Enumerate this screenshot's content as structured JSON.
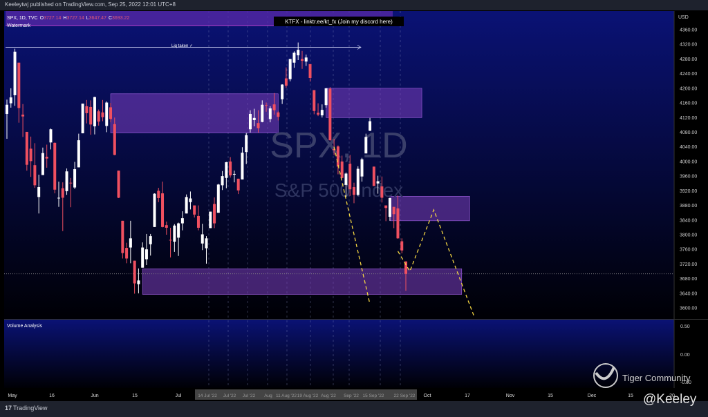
{
  "header": {
    "published": "Keeleytwj published on TradingView.com, Sep 25, 2022 12:01 UTC+8"
  },
  "legend": {
    "symbol": "SPX, 1D, TVC",
    "o_label": "O",
    "o": "3727.14",
    "h_label": "H",
    "h": "3727.14",
    "l_label": "L",
    "l": "3647.47",
    "c_label": "C",
    "c": "3693.22",
    "indicator": "Watermark"
  },
  "banner": "KTFX - linktr.ee/kt_fx (Join my discord here)",
  "annotation": "Liq taken ✓",
  "watermark": {
    "title": "SPX, 1D",
    "subtitle": "S&P 500 Index"
  },
  "volume_pane": {
    "title": "Volume Analysis",
    "ticks": [
      "0.50",
      "0.00",
      "-0.50"
    ]
  },
  "logo": {
    "text": "Tiger Community",
    "icon": "tiger-logo-icon"
  },
  "signature": "@Keeley",
  "footer": {
    "brand_icon": "tradingview-logo-icon",
    "brand": "TradingView"
  },
  "colors": {
    "up": "#ffffff",
    "down": "#f05060",
    "zone": "#7b3fbf",
    "projection": "#f5d742",
    "background_top": "#0a1275"
  },
  "chart_data": {
    "type": "candlestick",
    "currency": "USD",
    "price_ticks": [
      4360,
      4320,
      4280,
      4240,
      4200,
      4160,
      4120,
      4080,
      4040,
      4000,
      3960,
      3920,
      3880,
      3840,
      3800,
      3760,
      3720,
      3680,
      3640,
      3600
    ],
    "ylim": [
      3580,
      4400
    ],
    "x_ticks": [
      "May",
      "16",
      "Jun",
      "15",
      "Jul",
      "Oct",
      "17",
      "Nov",
      "15",
      "Dec",
      "15",
      "20"
    ],
    "x_ticks_grey": [
      "14 Jul '22",
      "Jul '22",
      "Jul '22",
      "Aug",
      "11 Aug '22",
      "19 Aug '22",
      "Aug '22",
      "Sep '22",
      "15 Sep '22",
      "22 Sep '22"
    ],
    "current_price": 3693.22,
    "liq_level": 4312,
    "zones": [
      {
        "from": 26,
        "to": 68,
        "top": 4185,
        "bottom": 4078
      },
      {
        "from": 80,
        "to": 104,
        "top": 4200,
        "bottom": 4120
      },
      {
        "from": 96,
        "to": 116,
        "top": 3905,
        "bottom": 3838
      },
      {
        "from": 34,
        "to": 114,
        "top": 3707,
        "bottom": 3637
      }
    ],
    "ohlc": [
      [
        4130,
        4169,
        4062,
        4155
      ],
      [
        4159,
        4200,
        4147,
        4175
      ],
      [
        4181,
        4308,
        4152,
        4300
      ],
      [
        4270,
        4270,
        4106,
        4146
      ],
      [
        4128,
        4157,
        4067,
        4123
      ],
      [
        4081,
        4081,
        3975,
        3991
      ],
      [
        4035,
        4068,
        3958,
        4001
      ],
      [
        3990,
        4050,
        3928,
        3935
      ],
      [
        3903,
        3964,
        3858,
        3930
      ],
      [
        3963,
        4038,
        3963,
        4023
      ],
      [
        4013,
        4046,
        3983,
        4008
      ],
      [
        4052,
        4090,
        4033,
        4088
      ],
      [
        4051,
        4052,
        3913,
        3923
      ],
      [
        3899,
        3945,
        3876,
        3901
      ],
      [
        3927,
        3943,
        3810,
        3901
      ],
      [
        3919,
        3981,
        3909,
        3973
      ],
      [
        3942,
        3955,
        3875,
        3941
      ],
      [
        3929,
        3999,
        3925,
        3979
      ],
      [
        3984,
        4076,
        3984,
        4058
      ],
      [
        4077,
        4158,
        4077,
        4158
      ],
      [
        4151,
        4168,
        4104,
        4132
      ],
      [
        4149,
        4167,
        4073,
        4101
      ],
      [
        4096,
        4177,
        4074,
        4176
      ],
      [
        4137,
        4142,
        4098,
        4109
      ],
      [
        4134,
        4168,
        4110,
        4121
      ],
      [
        4097,
        4164,
        4080,
        4161
      ],
      [
        4148,
        4160,
        4107,
        4116
      ],
      [
        4102,
        4120,
        4017,
        4018
      ],
      [
        3975,
        3975,
        3900,
        3901
      ],
      [
        3838,
        3838,
        3735,
        3750
      ],
      [
        3764,
        3778,
        3722,
        3735
      ],
      [
        3765,
        3838,
        3722,
        3790
      ],
      [
        3729,
        3729,
        3639,
        3667
      ],
      [
        3665,
        3708,
        3640,
        3675
      ],
      [
        3710,
        3779,
        3710,
        3765
      ],
      [
        3733,
        3802,
        3717,
        3760
      ],
      [
        3774,
        3802,
        3743,
        3796
      ],
      [
        3821,
        3913,
        3821,
        3912
      ],
      [
        3920,
        3928,
        3889,
        3900
      ],
      [
        3913,
        3945,
        3820,
        3821
      ],
      [
        3826,
        3836,
        3800,
        3819
      ],
      [
        3786,
        3819,
        3738,
        3785
      ],
      [
        3781,
        3829,
        3753,
        3825
      ],
      [
        3792,
        3833,
        3742,
        3831
      ],
      [
        3831,
        3864,
        3812,
        3845
      ],
      [
        3858,
        3910,
        3858,
        3903
      ],
      [
        3889,
        3918,
        3869,
        3899
      ],
      [
        3880,
        3880,
        3847,
        3855
      ],
      [
        3851,
        3880,
        3812,
        3819
      ],
      [
        3776,
        3830,
        3758,
        3801
      ],
      [
        3763,
        3796,
        3721,
        3790
      ],
      [
        3818,
        3863,
        3818,
        3863
      ],
      [
        3884,
        3902,
        3818,
        3831
      ],
      [
        3860,
        3939,
        3860,
        3937
      ],
      [
        3935,
        3974,
        3922,
        3960
      ],
      [
        3955,
        3999,
        3927,
        3998
      ],
      [
        4000,
        4012,
        3956,
        3962
      ],
      [
        3966,
        3975,
        3943,
        3966
      ],
      [
        3953,
        3953,
        3911,
        3921
      ],
      [
        3951,
        4039,
        3951,
        4024
      ],
      [
        4026,
        4078,
        3993,
        4072
      ],
      [
        4088,
        4140,
        4079,
        4130
      ],
      [
        4113,
        4144,
        4096,
        4119
      ],
      [
        4105,
        4140,
        4079,
        4091
      ],
      [
        4108,
        4167,
        4107,
        4155
      ],
      [
        4154,
        4161,
        4136,
        4152
      ],
      [
        4116,
        4151,
        4107,
        4145
      ],
      [
        4156,
        4187,
        4128,
        4140
      ],
      [
        4134,
        4137,
        4112,
        4122
      ],
      [
        4170,
        4211,
        4157,
        4210
      ],
      [
        4227,
        4257,
        4201,
        4207
      ],
      [
        4225,
        4280,
        4219,
        4280
      ],
      [
        4270,
        4301,
        4256,
        4297
      ],
      [
        4290,
        4325,
        4277,
        4305
      ],
      [
        4280,
        4302,
        4253,
        4275
      ],
      [
        4273,
        4292,
        4261,
        4284
      ],
      [
        4266,
        4266,
        4218,
        4228
      ],
      [
        4195,
        4195,
        4129,
        4138
      ],
      [
        4133,
        4159,
        4124,
        4128
      ],
      [
        4126,
        4156,
        4120,
        4141
      ],
      [
        4154,
        4200,
        4147,
        4200
      ],
      [
        4199,
        4203,
        4057,
        4058
      ],
      [
        4034,
        4062,
        4017,
        4031
      ],
      [
        4041,
        4044,
        3965,
        3986
      ],
      [
        4000,
        4016,
        3954,
        3955
      ],
      [
        3936,
        3970,
        3903,
        3967
      ],
      [
        3994,
        4018,
        3906,
        3924
      ],
      [
        3930,
        3942,
        3886,
        3909
      ],
      [
        3909,
        3987,
        3906,
        3980
      ],
      [
        3959,
        4010,
        3945,
        4006
      ],
      [
        4022,
        4076,
        4022,
        4067
      ],
      [
        4084,
        4119,
        4083,
        4110
      ],
      [
        3986,
        3986,
        3933,
        3933
      ],
      [
        3940,
        3961,
        3912,
        3946
      ],
      [
        3932,
        3959,
        3888,
        3901
      ],
      [
        3880,
        3880,
        3837,
        3873
      ],
      [
        3849,
        3900,
        3838,
        3900
      ],
      [
        3876,
        3876,
        3818,
        3856
      ],
      [
        3872,
        3907,
        3789,
        3790
      ],
      [
        3782,
        3790,
        3749,
        3757
      ],
      [
        3727,
        3727,
        3647,
        3693
      ]
    ],
    "projection_a": [
      [
        82,
        4040
      ],
      [
        91,
        3610
      ]
    ],
    "projection_b": [
      [
        98,
        3755
      ],
      [
        101,
        3700
      ],
      [
        107,
        3868
      ],
      [
        117,
        3580
      ]
    ]
  }
}
